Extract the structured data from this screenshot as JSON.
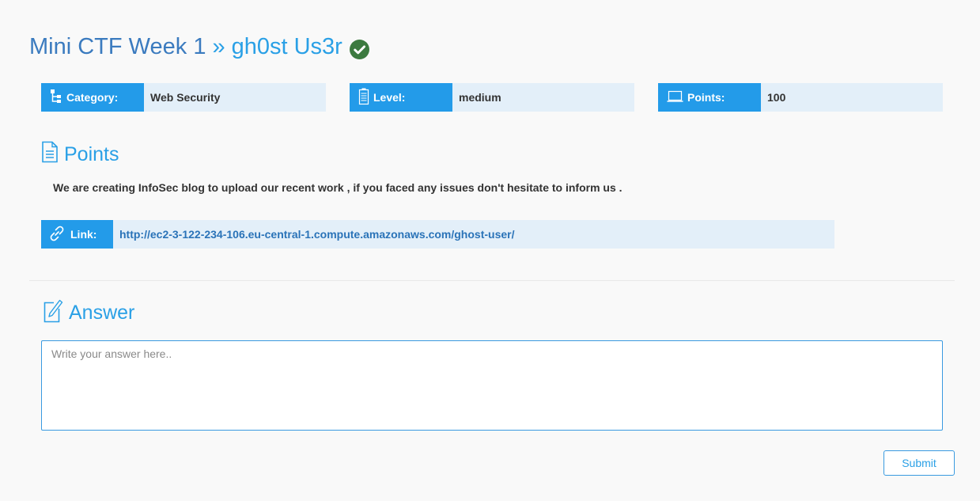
{
  "header": {
    "event": "Mini CTF Week 1",
    "separator": "»",
    "challenge": "gh0st Us3r",
    "solved_icon": "check-circle-icon"
  },
  "info": {
    "category": {
      "label": "Category:",
      "value": "Web Security",
      "icon": "sitemap-icon"
    },
    "level": {
      "label": "Level:",
      "value": "medium",
      "icon": "battery-icon"
    },
    "points": {
      "label": "Points:",
      "value": "100",
      "icon": "laptop-icon"
    }
  },
  "points_section": {
    "heading": "Points",
    "icon": "document-icon",
    "description": "We are creating InfoSec blog to upload our recent work , if you faced any issues don't hesitate to inform us ."
  },
  "link": {
    "label": "Link:",
    "url": "http://ec2-3-122-234-106.eu-central-1.compute.amazonaws.com/ghost-user/",
    "icon": "link-icon"
  },
  "answer_section": {
    "heading": "Answer",
    "icon": "edit-icon",
    "placeholder": "Write your answer here..",
    "submit_label": "Submit"
  },
  "colors": {
    "accent": "#239be9",
    "title_dark": "#3b7bbf",
    "info_bg": "#e3eff9",
    "solved": "#3c7a3f"
  }
}
